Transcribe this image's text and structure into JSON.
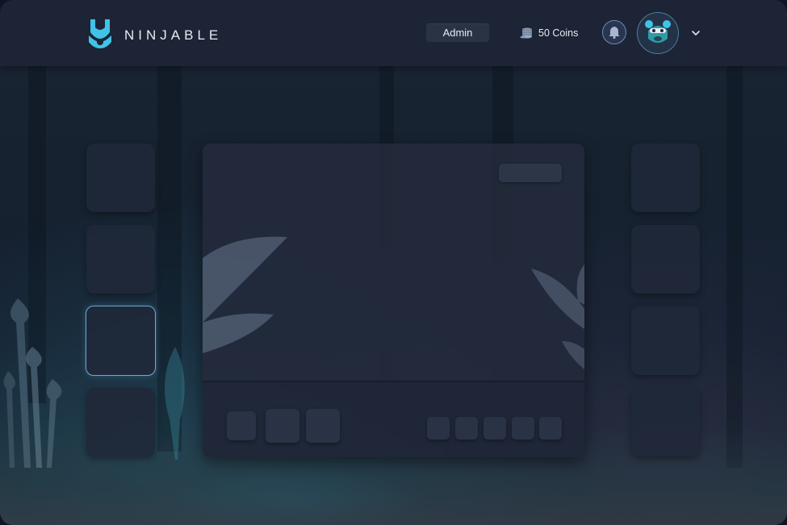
{
  "header": {
    "brand": "NINJABLE",
    "role_label": "Admin",
    "coins_label": "50 Coins",
    "icons": {
      "logo": "ninjable-logo-icon",
      "coins": "coin-stack-icon",
      "bell": "bell-icon",
      "avatar": "avatar-icon",
      "menu": "chevron-down-icon"
    }
  },
  "colors": {
    "header_bg": "#1c2435",
    "logo_accent": "#3fc4e8",
    "slot_bg": "#202838",
    "selected_border": "#6fa8d0",
    "panel_bg": "#222a3b"
  },
  "left_slots": [
    {
      "selected": false
    },
    {
      "selected": false
    },
    {
      "selected": true
    },
    {
      "selected": false
    }
  ],
  "right_slots": [
    {
      "selected": false
    },
    {
      "selected": false
    },
    {
      "selected": false
    },
    {
      "selected": false
    }
  ],
  "panel": {
    "large_tiles": 3,
    "small_tiles": 5
  }
}
